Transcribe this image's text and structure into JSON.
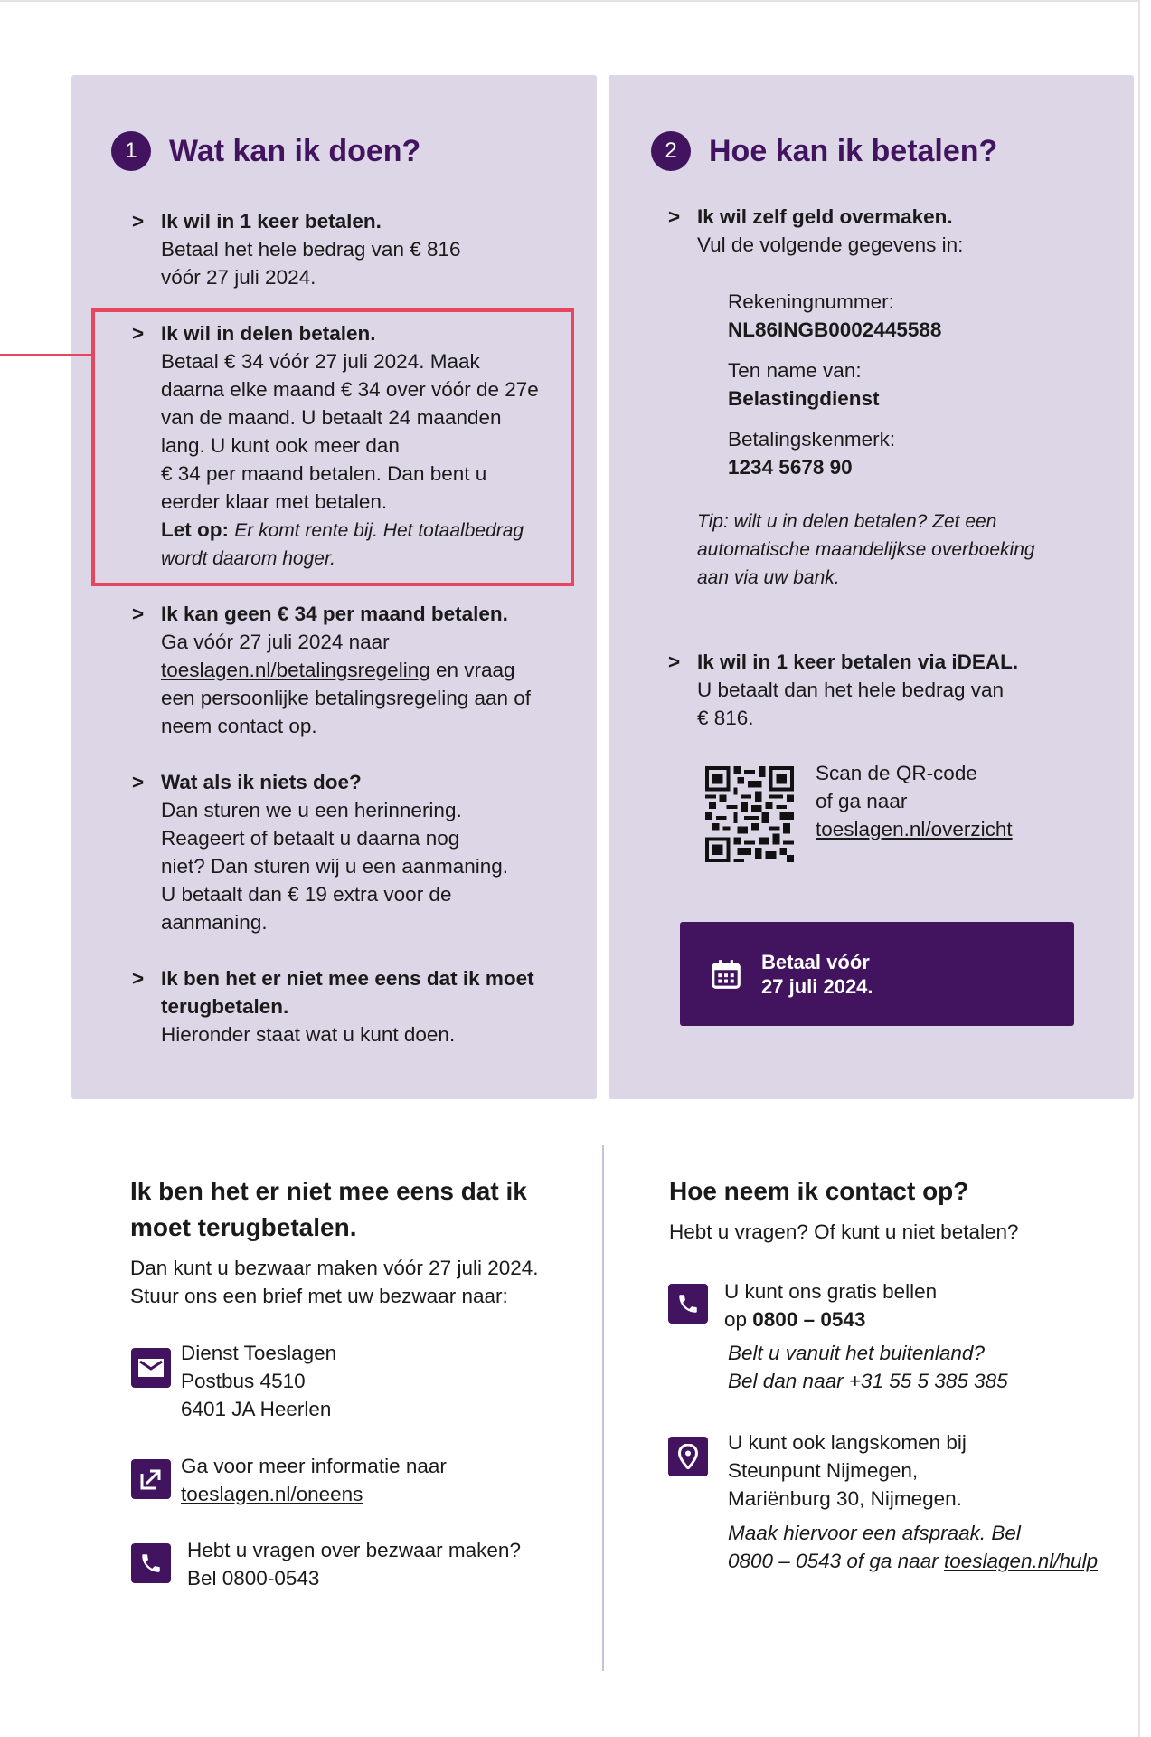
{
  "panel1": {
    "number": "1",
    "title": "Wat kan ik doen?",
    "items": [
      {
        "bullet": ">",
        "heading": "Ik wil in 1 keer betalen.",
        "lines": [
          "Betaal het hele bedrag van € 816",
          "vóór 27 juli 2024."
        ]
      },
      {
        "bullet": ">",
        "heading": "Ik wil in delen betalen.",
        "lines": [
          "Betaal € 34 vóór 27 juli 2024. Maak",
          "daarna elke maand € 34 over vóór de 27e",
          "van de maand. U betaalt 24 maanden",
          "lang. U kunt ook meer dan",
          "€ 34 per maand betalen. Dan bent u",
          "eerder klaar met betalen."
        ],
        "note_label": "Let op:",
        "note_line1": "Er komt rente bij. Het totaalbedrag",
        "note_line2": "wordt daarom hoger."
      },
      {
        "bullet": ">",
        "heading": "Ik kan geen € 34 per maand betalen.",
        "line1": "Ga vóór 27 juli 2024 naar",
        "link": "toeslagen.nl/betalingsregeling",
        "line2_rest": " en vraag",
        "line3": "een persoonlijke betalingsregeling aan of",
        "line4": "neem contact op."
      },
      {
        "bullet": ">",
        "heading": "Wat als ik niets doe?",
        "lines": [
          "Dan sturen we u een herinnering.",
          "Reageert of betaalt u daarna nog",
          "niet? Dan sturen wij u een aanmaning.",
          "U betaalt dan € 19 extra voor de",
          "aanmaning."
        ]
      },
      {
        "bullet": ">",
        "heading1": "Ik ben het er niet mee eens dat ik moet",
        "heading2": "terugbetalen.",
        "line": "Hieronder staat wat u kunt doen."
      }
    ]
  },
  "panel2": {
    "number": "2",
    "title": "Hoe kan ik betalen?",
    "transfer_heading": "Ik wil zelf geld overmaken.",
    "transfer_text": "Vul de volgende gegevens in:",
    "account_label": "Rekeningnummer:",
    "account_value": "NL86INGB0002445588",
    "name_label": "Ten name van:",
    "name_value": "Belastingdienst",
    "ref_label": "Betalingskenmerk:",
    "ref_value": "1234 5678 90",
    "tip_lines": [
      "Tip: wilt u in delen betalen? Zet een",
      "automatische maandelijkse overboeking",
      "aan via uw bank."
    ],
    "ideal_heading": "Ik wil in 1 keer betalen via iDEAL.",
    "ideal_lines": [
      "U betaalt dan het hele bedrag van",
      "€ 816."
    ],
    "qr_line1": "Scan de QR-code",
    "qr_line2": "of ga naar",
    "qr_link": "toeslagen.nl/overzicht",
    "pay_button_line1": "Betaal vóór",
    "pay_button_line2": "27 juli 2024.",
    "pay_icon": "calendar-icon"
  },
  "objection": {
    "title_line1": "Ik ben het er niet mee eens dat ik",
    "title_line2": "moet terugbetalen.",
    "intro_line1": "Dan kunt u bezwaar maken vóór 27 juli 2024.",
    "intro_line2": "Stuur ons een brief met uw bezwaar naar:",
    "address": [
      "Dienst Toeslagen",
      "Postbus 4510",
      "6401 JA Heerlen"
    ],
    "info_line1": "Ga voor meer informatie naar",
    "info_link": "toeslagen.nl/oneens",
    "phone_line1": "Hebt u vragen over bezwaar maken?",
    "phone_line2": "Bel 0800-0543"
  },
  "contact": {
    "title": "Hoe neem ik contact op?",
    "intro": "Hebt u vragen? Of kunt u niet betalen?",
    "call_line1": "U kunt ons gratis bellen",
    "call_prefix": "op ",
    "call_number": "0800 – 0543",
    "abroad_line1": "Belt u vanuit het buitenland?",
    "abroad_line2": "Bel dan naar +31 55 5 385 385",
    "visit_lines": [
      "U kunt ook langskomen bij",
      "Steunpunt Nijmegen,",
      "Mariënburg 30, Nijmegen."
    ],
    "appointment_line1": "Maak hiervoor een afspraak. Bel",
    "appointment_prefix": "0800 – 0543 of ga naar ",
    "appointment_link": "toeslagen.nl/hulp"
  },
  "colors": {
    "accent": "#42145f",
    "panel_bg": "#dcd6e6",
    "highlight": "#e8455e"
  }
}
